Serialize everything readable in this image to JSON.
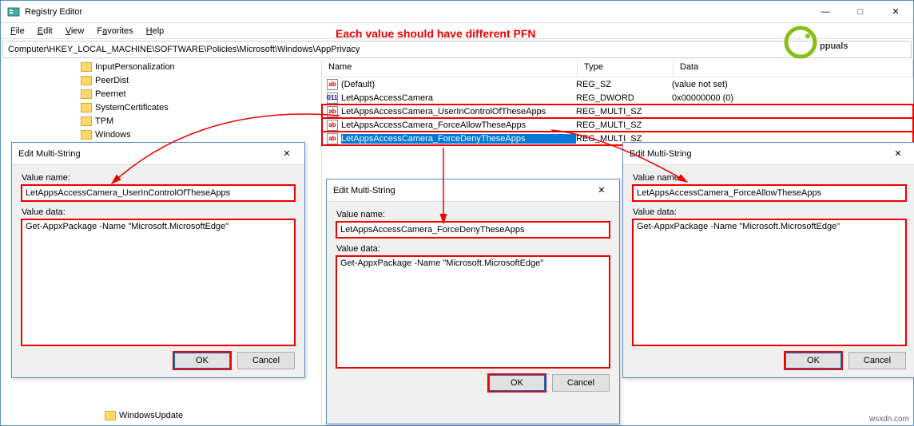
{
  "window": {
    "title": "Registry Editor",
    "menu": {
      "file": "File",
      "edit": "Edit",
      "view": "View",
      "favorites": "Favorites",
      "help": "Help"
    },
    "address": "Computer\\HKEY_LOCAL_MACHINE\\SOFTWARE\\Policies\\Microsoft\\Windows\\AppPrivacy"
  },
  "tree": {
    "items": [
      "InputPersonalization",
      "PeerDist",
      "Peernet",
      "SystemCertificates",
      "TPM",
      "Windows"
    ],
    "lastItem": "WindowsUpdate"
  },
  "list": {
    "headers": {
      "name": "Name",
      "type": "Type",
      "data": "Data"
    },
    "rows": [
      {
        "icon": "ab",
        "name": "(Default)",
        "type": "REG_SZ",
        "data": "(value not set)",
        "selected": false,
        "boxed": false
      },
      {
        "icon": "bin",
        "name": "LetAppsAccessCamera",
        "type": "REG_DWORD",
        "data": "0x00000000 (0)",
        "selected": false,
        "boxed": false
      },
      {
        "icon": "ab",
        "name": "LetAppsAccessCamera_UserInControlOfTheseApps",
        "type": "REG_MULTI_SZ",
        "data": "",
        "selected": false,
        "boxed": true
      },
      {
        "icon": "ab",
        "name": "LetAppsAccessCamera_ForceAllowTheseApps",
        "type": "REG_MULTI_SZ",
        "data": "",
        "selected": false,
        "boxed": true
      },
      {
        "icon": "ab",
        "name": "LetAppsAccessCamera_ForceDenyTheseApps",
        "type": "REG_MULTI_SZ",
        "data": "",
        "selected": true,
        "boxed": true
      }
    ]
  },
  "dialogs": {
    "title": "Edit Multi-String",
    "valueNameLabel": "Value name:",
    "valueDataLabel": "Value data:",
    "ok": "OK",
    "cancel": "Cancel",
    "d1": {
      "valueName": "LetAppsAccessCamera_UserInControlOfTheseApps",
      "valueData": "Get-AppxPackage -Name \"Microsoft.MicrosoftEdge\""
    },
    "d2": {
      "valueName": "LetAppsAccessCamera_ForceDenyTheseApps",
      "valueData": "Get-AppxPackage -Name \"Microsoft.MicrosoftEdge\""
    },
    "d3": {
      "valueName": "LetAppsAccessCamera_ForceAllowTheseApps",
      "valueData": "Get-AppxPackage -Name \"Microsoft.MicrosoftEdge\""
    }
  },
  "annotation": "Each value should have different PFN",
  "watermark": "Appuals",
  "source": "wsxdn.com"
}
